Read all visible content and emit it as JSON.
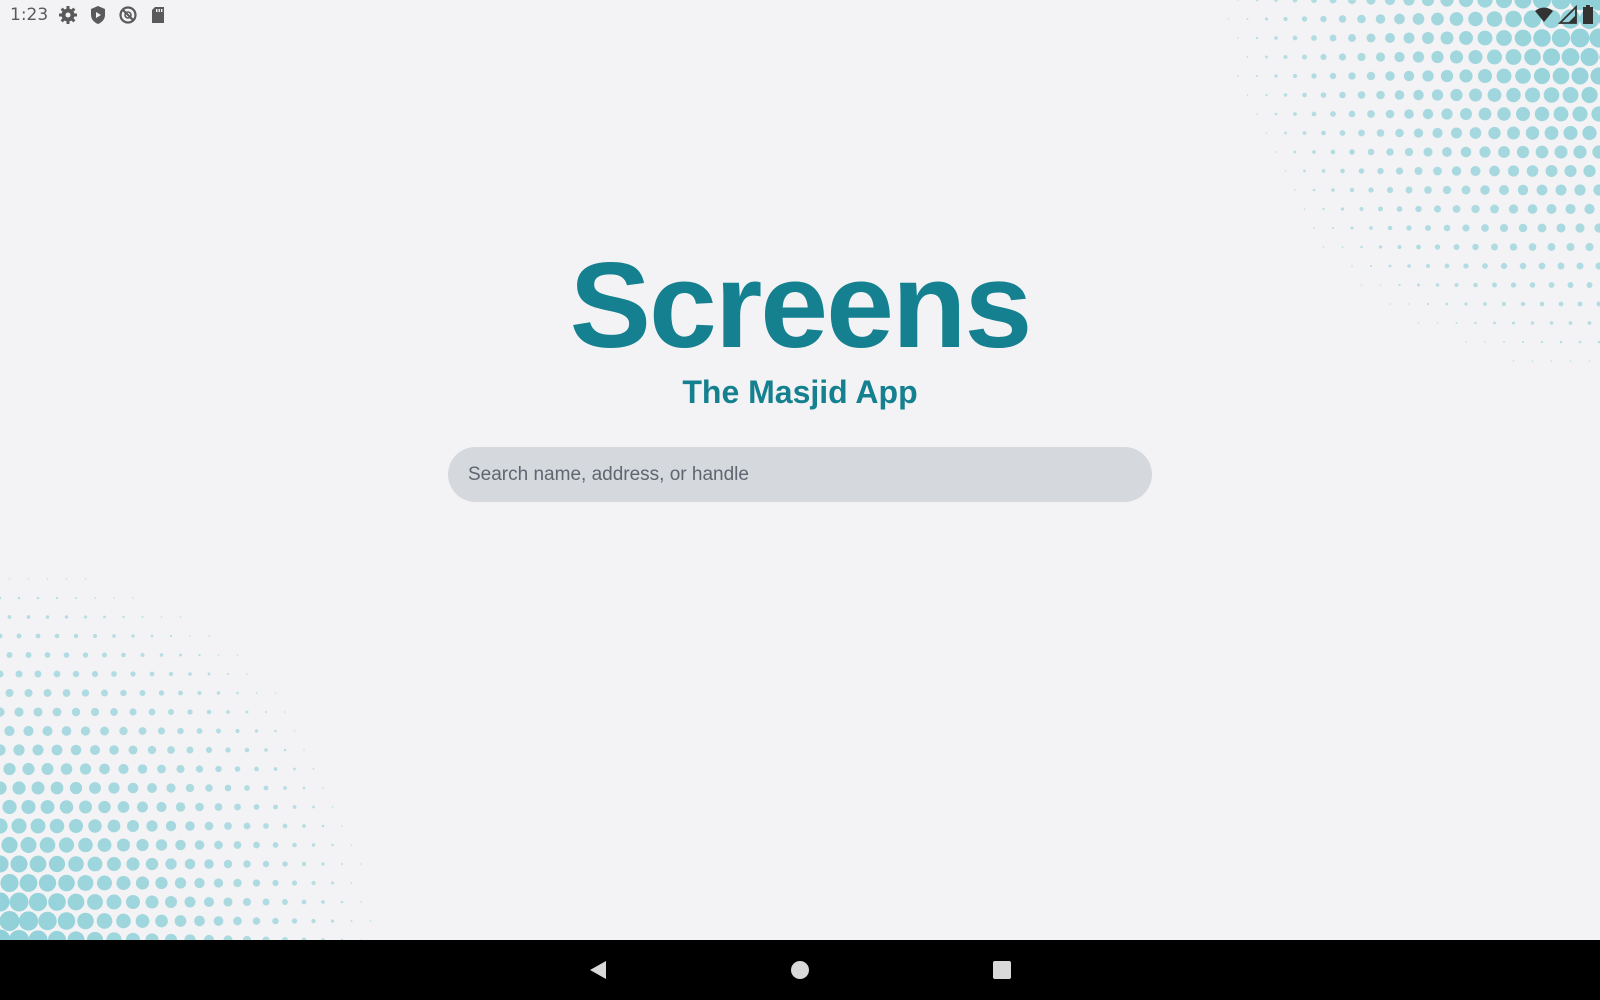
{
  "status_bar": {
    "time": "1:23",
    "left_icons": [
      "settings-icon",
      "shield-icon",
      "data-saver-icon",
      "sd-card-icon"
    ],
    "right_icons": [
      "wifi-icon",
      "signal-icon",
      "battery-icon"
    ]
  },
  "brand": {
    "title": "Screens",
    "subtitle": "The Masjid App",
    "color": "#15808f"
  },
  "search": {
    "placeholder": "Search name, address, or handle",
    "value": ""
  },
  "decoration": {
    "dot_color": "#8fd0d8"
  },
  "nav_bar": {
    "buttons": [
      "back-icon",
      "home-icon",
      "recents-icon"
    ]
  }
}
